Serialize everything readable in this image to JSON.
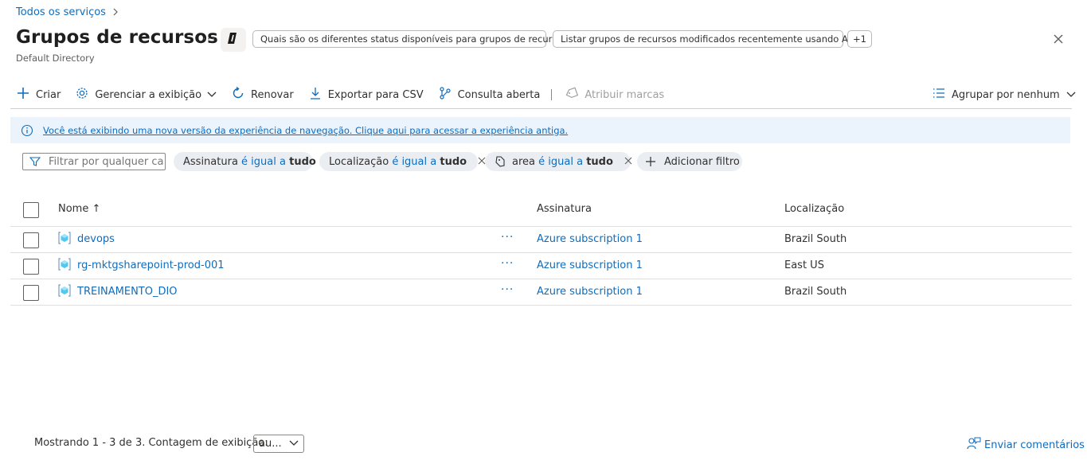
{
  "breadcrumb": {
    "items": [
      "Todos os serviços"
    ]
  },
  "header": {
    "title": "Grupos de recursos",
    "subtitle": "Default Directory",
    "suggestions": [
      "Quais são os diferentes status disponíveis para grupos de recursos?",
      "Listar grupos de recursos modificados recentemente usando ARG."
    ],
    "more_suggestions": "+1"
  },
  "toolbar": {
    "create": "Criar",
    "manage_view": "Gerenciar a exibição",
    "refresh": "Renovar",
    "export_csv": "Exportar para CSV",
    "open_query": "Consulta aberta",
    "assign_tags": "Atribuir marcas",
    "group_by": "Agrupar por nenhum"
  },
  "infobar": {
    "message": "Você está exibindo uma nova versão da experiência de navegação. Clique aqui para acessar a experiência antiga."
  },
  "filters": {
    "search_placeholder": "Filtrar por qualquer ca...",
    "chips": [
      {
        "field": "Assinatura",
        "operator": "é igual a",
        "value": "tudo"
      },
      {
        "field": "Localização",
        "operator": "é igual a",
        "value": "tudo"
      },
      {
        "field": "area",
        "operator": "é igual a",
        "value": "tudo"
      }
    ],
    "add_filter": "Adicionar filtro"
  },
  "table": {
    "columns": {
      "name": "Nome ↑",
      "subscription": "Assinatura",
      "location": "Localização"
    },
    "rows": [
      {
        "name": "devops",
        "actions": "···",
        "subscription": "Azure subscription 1",
        "location": "Brazil South"
      },
      {
        "name": "rg-mktgsharepoint-prod-001",
        "actions": "···",
        "subscription": "Azure subscription 1",
        "location": "East US"
      },
      {
        "name": "TREINAMENTO_DIO",
        "actions": "···",
        "subscription": "Azure subscription 1",
        "location": "Brazil South"
      }
    ]
  },
  "footer": {
    "showing": "Mostrando 1 - 3 de 3. Contagem de exibição:",
    "page_size": "au...",
    "feedback": "Enviar comentários"
  },
  "colors": {
    "accent": "#0f6cbd",
    "info_bg": "#ebf3fc",
    "chip_bg": "#eaeef3"
  }
}
